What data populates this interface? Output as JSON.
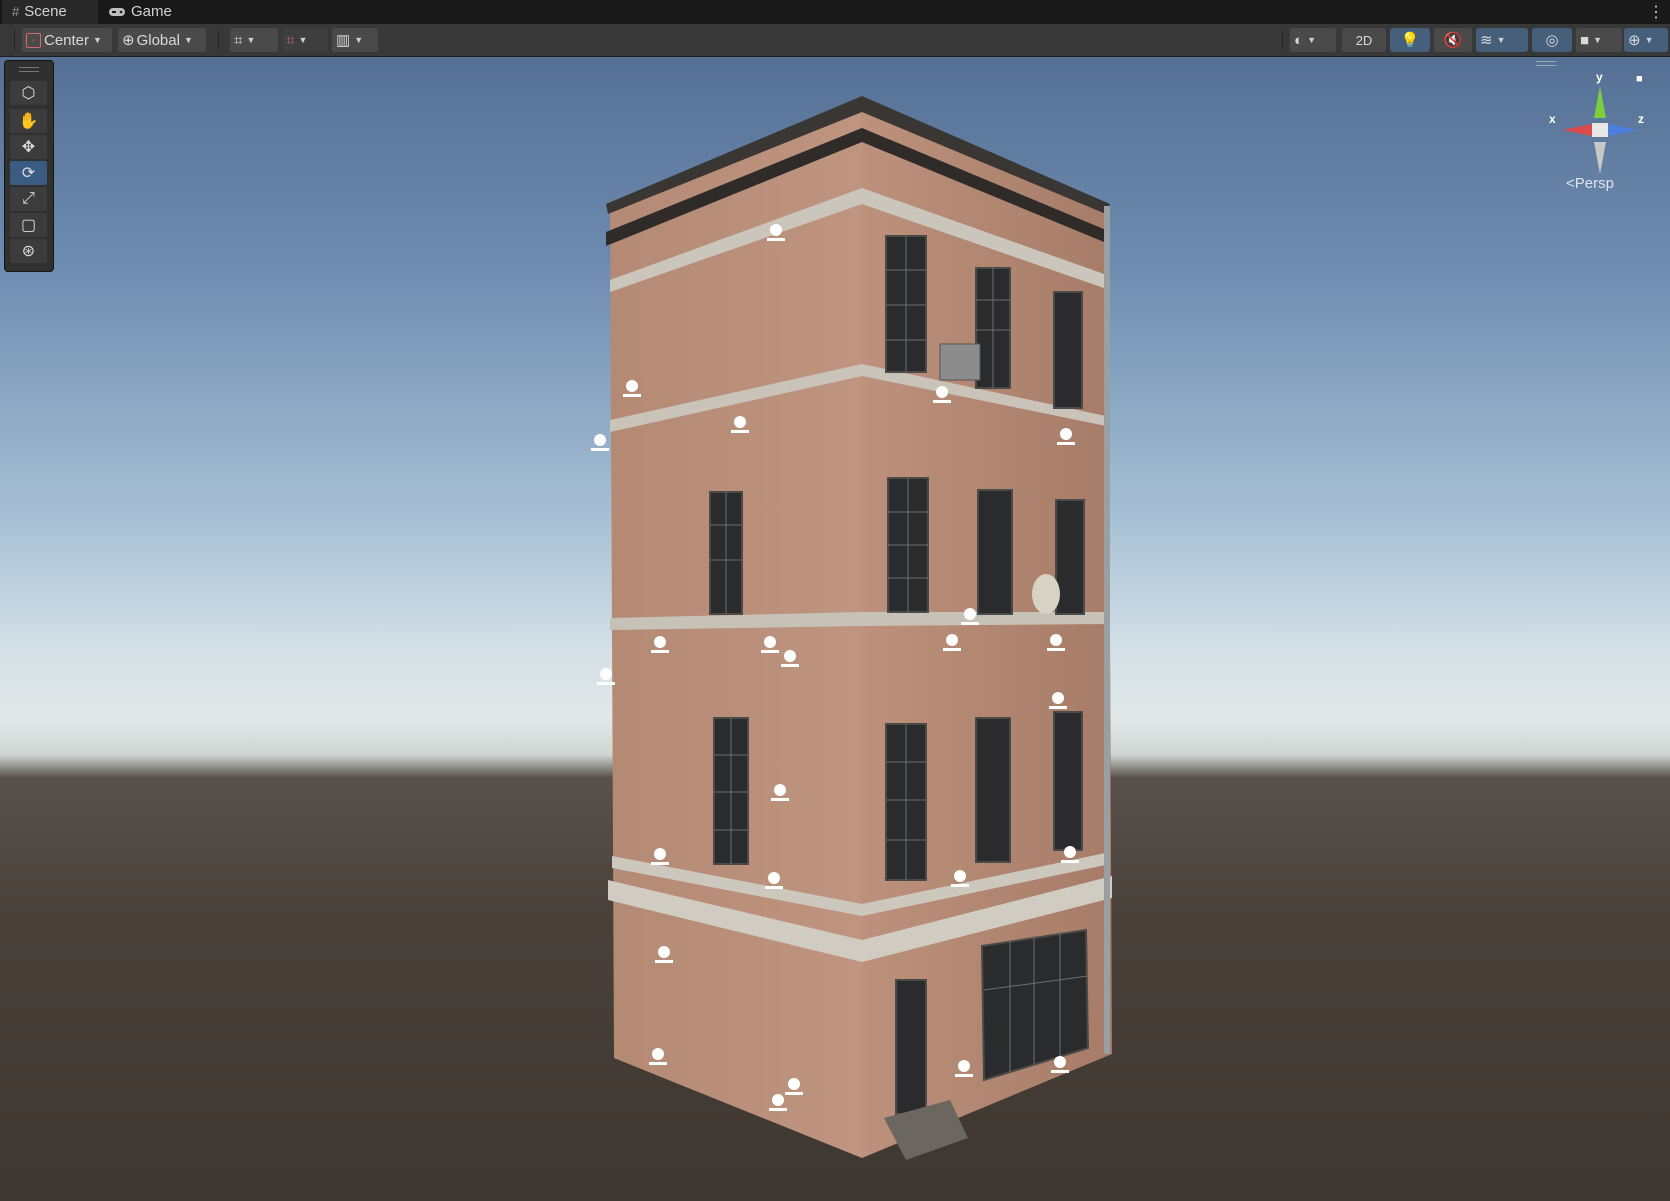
{
  "tabs": [
    {
      "label": "Scene",
      "icon": "hash-icon",
      "active": true
    },
    {
      "label": "Game",
      "icon": "gamepad-icon",
      "active": false
    }
  ],
  "toolbar": {
    "pivot": "Center",
    "space": "Global",
    "mode_2d": "2D"
  },
  "gizmo": {
    "x": "x",
    "y": "y",
    "z": "z",
    "projection": "Persp"
  },
  "colors": {
    "panel": "#383838",
    "tab_bg": "#191919",
    "active_tool": "#3b5c82",
    "wall": "#b98d77",
    "trim": "#c9c6bd"
  }
}
